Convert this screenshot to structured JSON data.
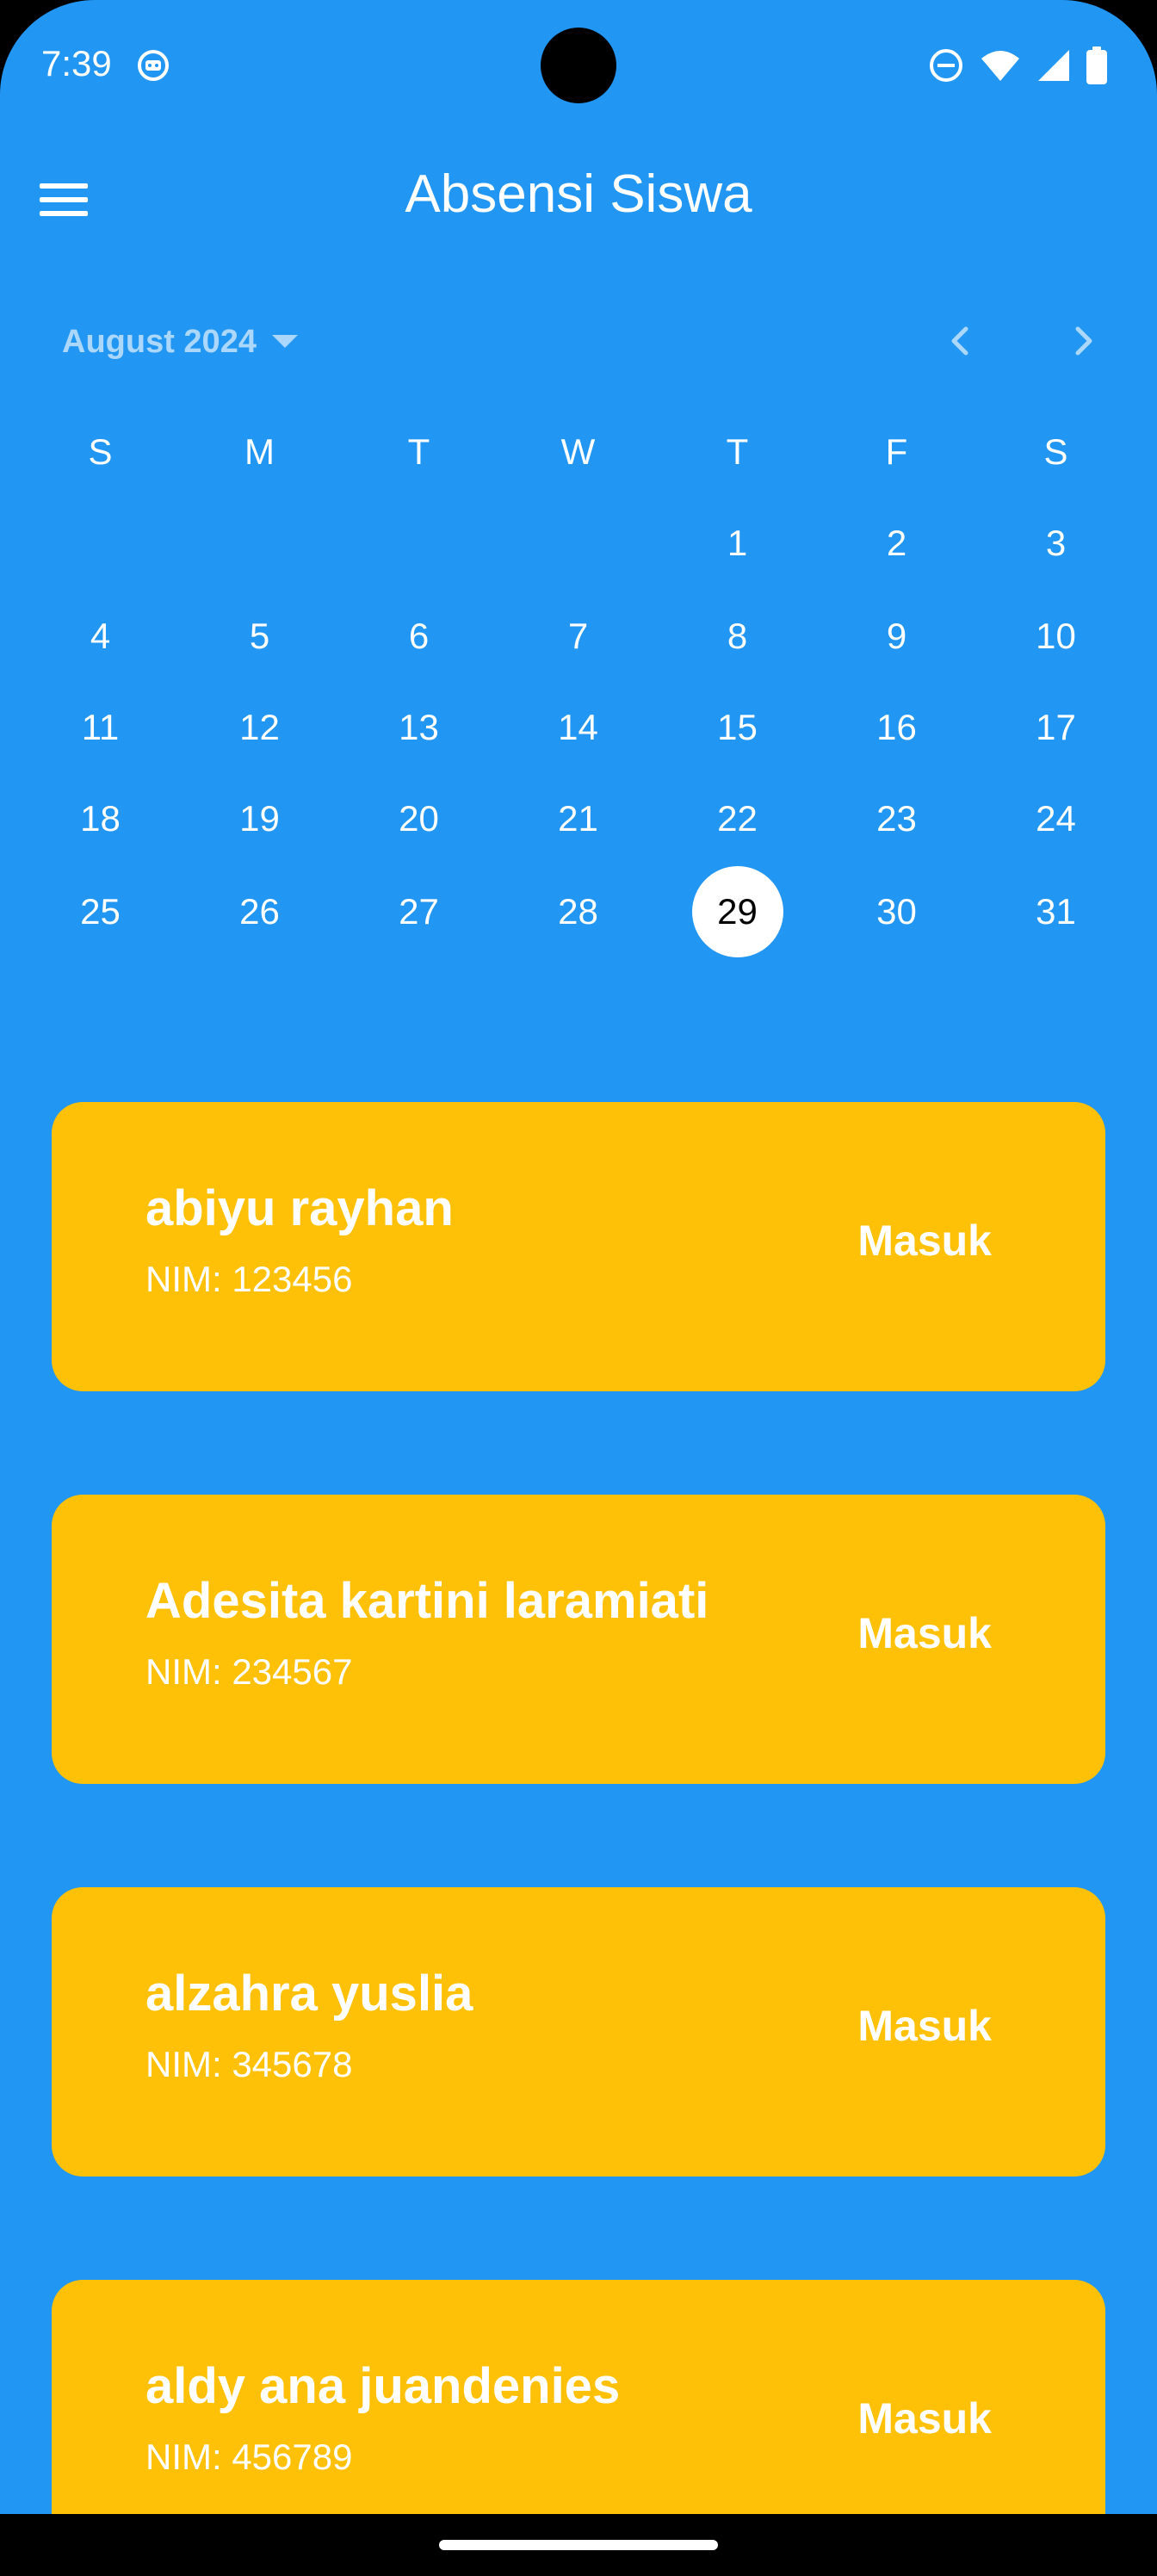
{
  "status_bar": {
    "time": "7:39",
    "icons": [
      "app-notification-icon",
      "do-not-disturb-icon",
      "wifi-icon",
      "cellular-signal-icon",
      "battery-icon"
    ]
  },
  "app_bar": {
    "title": "Absensi Siswa",
    "menu_icon": "hamburger-menu-icon"
  },
  "calendar": {
    "month_label": "August 2024",
    "weekdays": [
      "S",
      "M",
      "T",
      "W",
      "T",
      "F",
      "S"
    ],
    "first_weekday_index": 4,
    "days_in_month": 31,
    "selected_day": 29,
    "prev_icon": "chevron-left-icon",
    "next_icon": "chevron-right-icon"
  },
  "students": [
    {
      "name": "abiyu rayhan",
      "nim": "NIM: 123456",
      "status": "Masuk"
    },
    {
      "name": "Adesita kartini laramiati",
      "nim": "NIM: 234567",
      "status": "Masuk"
    },
    {
      "name": "alzahra yuslia",
      "nim": "NIM: 345678",
      "status": "Masuk"
    },
    {
      "name": "aldy ana juandenies",
      "nim": "NIM: 456789",
      "status": "Masuk"
    }
  ],
  "colors": {
    "background": "#2196F3",
    "card": "#FFC107",
    "text": "#FFFFFF"
  }
}
